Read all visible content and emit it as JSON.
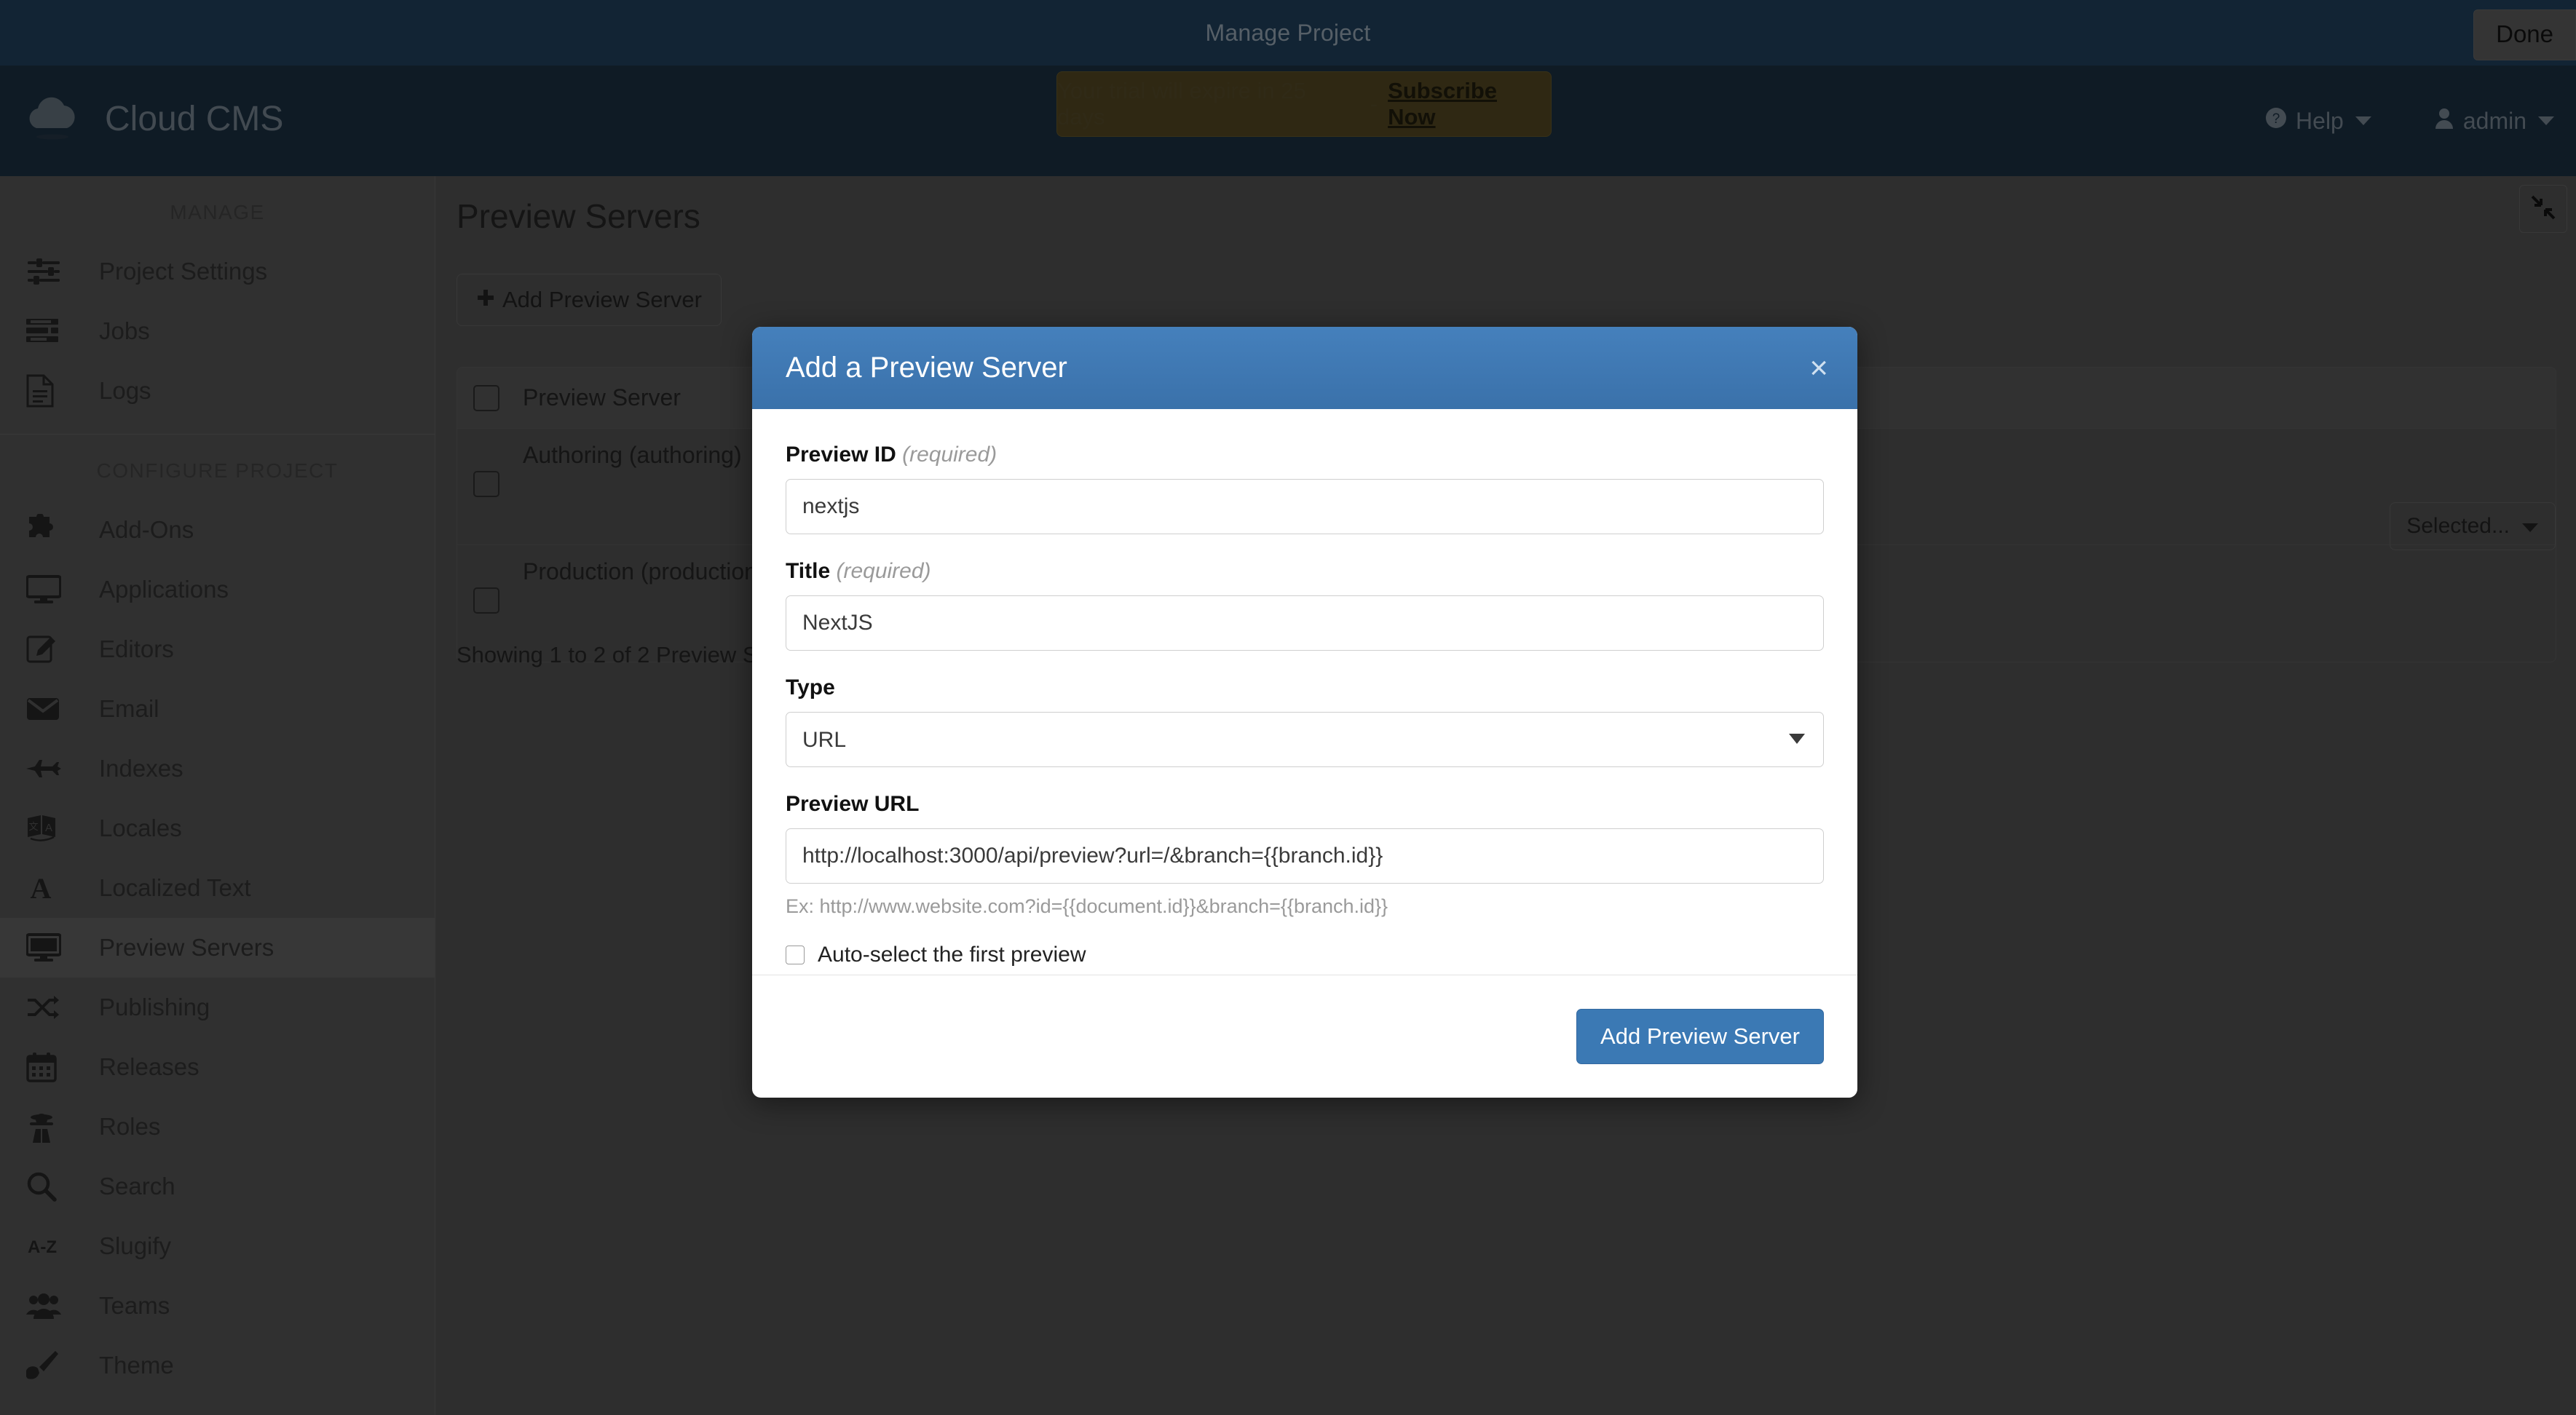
{
  "top_strip": {
    "title": "Manage Project",
    "done_label": "Done"
  },
  "header": {
    "brand_name": "Cloud CMS",
    "trial": {
      "text": "Your trial will expire in 25 days",
      "dash": "-",
      "subscribe_label": "Subscribe Now"
    },
    "help_label": "Help",
    "user_label": "admin"
  },
  "sidebar": {
    "groups": [
      {
        "title": "MANAGE",
        "items": [
          {
            "label": "Project Settings",
            "icon": "sliders-icon",
            "active": false
          },
          {
            "label": "Jobs",
            "icon": "tasks-icon",
            "active": false
          },
          {
            "label": "Logs",
            "icon": "file-lines-icon",
            "active": false
          }
        ]
      },
      {
        "title": "CONFIGURE PROJECT",
        "items": [
          {
            "label": "Add-Ons",
            "icon": "puzzle-piece-icon",
            "active": false
          },
          {
            "label": "Applications",
            "icon": "desktop-icon",
            "active": false
          },
          {
            "label": "Editors",
            "icon": "pen-square-icon",
            "active": false
          },
          {
            "label": "Email",
            "icon": "envelope-icon",
            "active": false
          },
          {
            "label": "Indexes",
            "icon": "jet-icon",
            "active": false
          },
          {
            "label": "Locales",
            "icon": "language-icon",
            "active": false
          },
          {
            "label": "Localized Text",
            "icon": "font-icon",
            "active": false
          },
          {
            "label": "Preview Servers",
            "icon": "monitor-icon",
            "active": true
          },
          {
            "label": "Publishing",
            "icon": "shuffle-icon",
            "active": false
          },
          {
            "label": "Releases",
            "icon": "calendar-icon",
            "active": false
          },
          {
            "label": "Roles",
            "icon": "user-secret-icon",
            "active": false
          },
          {
            "label": "Search",
            "icon": "search-icon",
            "active": false
          },
          {
            "label": "Slugify",
            "icon": "a-z-icon",
            "active": false
          },
          {
            "label": "Teams",
            "icon": "users-icon",
            "active": false
          },
          {
            "label": "Theme",
            "icon": "paint-brush-icon",
            "active": false
          }
        ]
      }
    ]
  },
  "main": {
    "page_title": "Preview Servers",
    "add_button_label": "Add Preview Server",
    "selected_dropdown_label": "Selected...",
    "table": {
      "header": "Preview Server",
      "rows": [
        {
          "label": "Authoring (authoring)"
        },
        {
          "label": "Production (production)"
        }
      ]
    },
    "showing_text": "Showing 1 to 2 of 2 Preview Servers"
  },
  "modal": {
    "title": "Add a Preview Server",
    "close_glyph": "×",
    "fields": {
      "preview_id": {
        "label": "Preview ID",
        "required_note": "(required)",
        "value": "nextjs",
        "placeholder": ""
      },
      "title": {
        "label": "Title",
        "required_note": "(required)",
        "value": "NextJS",
        "placeholder": ""
      },
      "type": {
        "label": "Type",
        "value": "URL",
        "options": [
          "URL"
        ]
      },
      "preview_url": {
        "label": "Preview URL",
        "value": "http://localhost:3000/api/preview?url=/&branch={{branch.id}}",
        "placeholder": "",
        "help": "Ex: http://www.website.com?id={{document.id}}&branch={{branch.id}}"
      },
      "auto_select": {
        "label": "Auto-select the first preview",
        "checked": false
      }
    },
    "submit_label": "Add Preview Server"
  },
  "colors": {
    "top_strip": "#1d3a54",
    "header_bar": "#192c3d",
    "modal_header": "#3a76b0",
    "primary_button": "#3b79b4",
    "trial_banner": "#4d4220",
    "sidebar": "#4e4e4e"
  }
}
